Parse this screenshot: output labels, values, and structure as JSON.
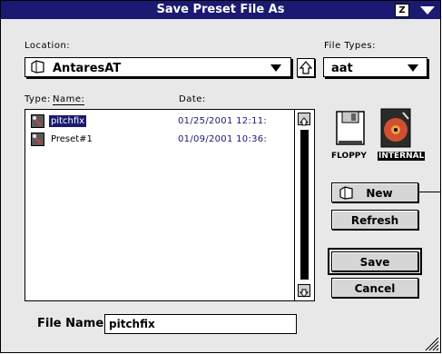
{
  "window": {
    "title": "Save Preset File As",
    "zoom_glyph": "Z"
  },
  "location": {
    "label": "Location:",
    "selected": "AntaresAT",
    "folder_icon": "folder-icon"
  },
  "file_types": {
    "label": "File Types:",
    "selected": "aat"
  },
  "list": {
    "type_label": "Type:",
    "name_label": "Name:",
    "date_label": "Date:",
    "items": [
      {
        "name": "pitchfix",
        "date": "01/25/2001  12:11:",
        "selected": true
      },
      {
        "name": "Preset#1",
        "date": "01/09/2001  10:36:",
        "selected": false
      }
    ]
  },
  "volumes": {
    "floppy": "FLOPPY",
    "internal": "INTERNAL"
  },
  "buttons": {
    "new": "New",
    "refresh": "Refresh",
    "save": "Save",
    "cancel": "Cancel"
  },
  "file_name": {
    "label": "File Name:",
    "value": "pitchfix"
  },
  "colors": {
    "title_bar": "#1a1a72",
    "selection": "#1a1a72",
    "date_text": "#1a1a72"
  }
}
